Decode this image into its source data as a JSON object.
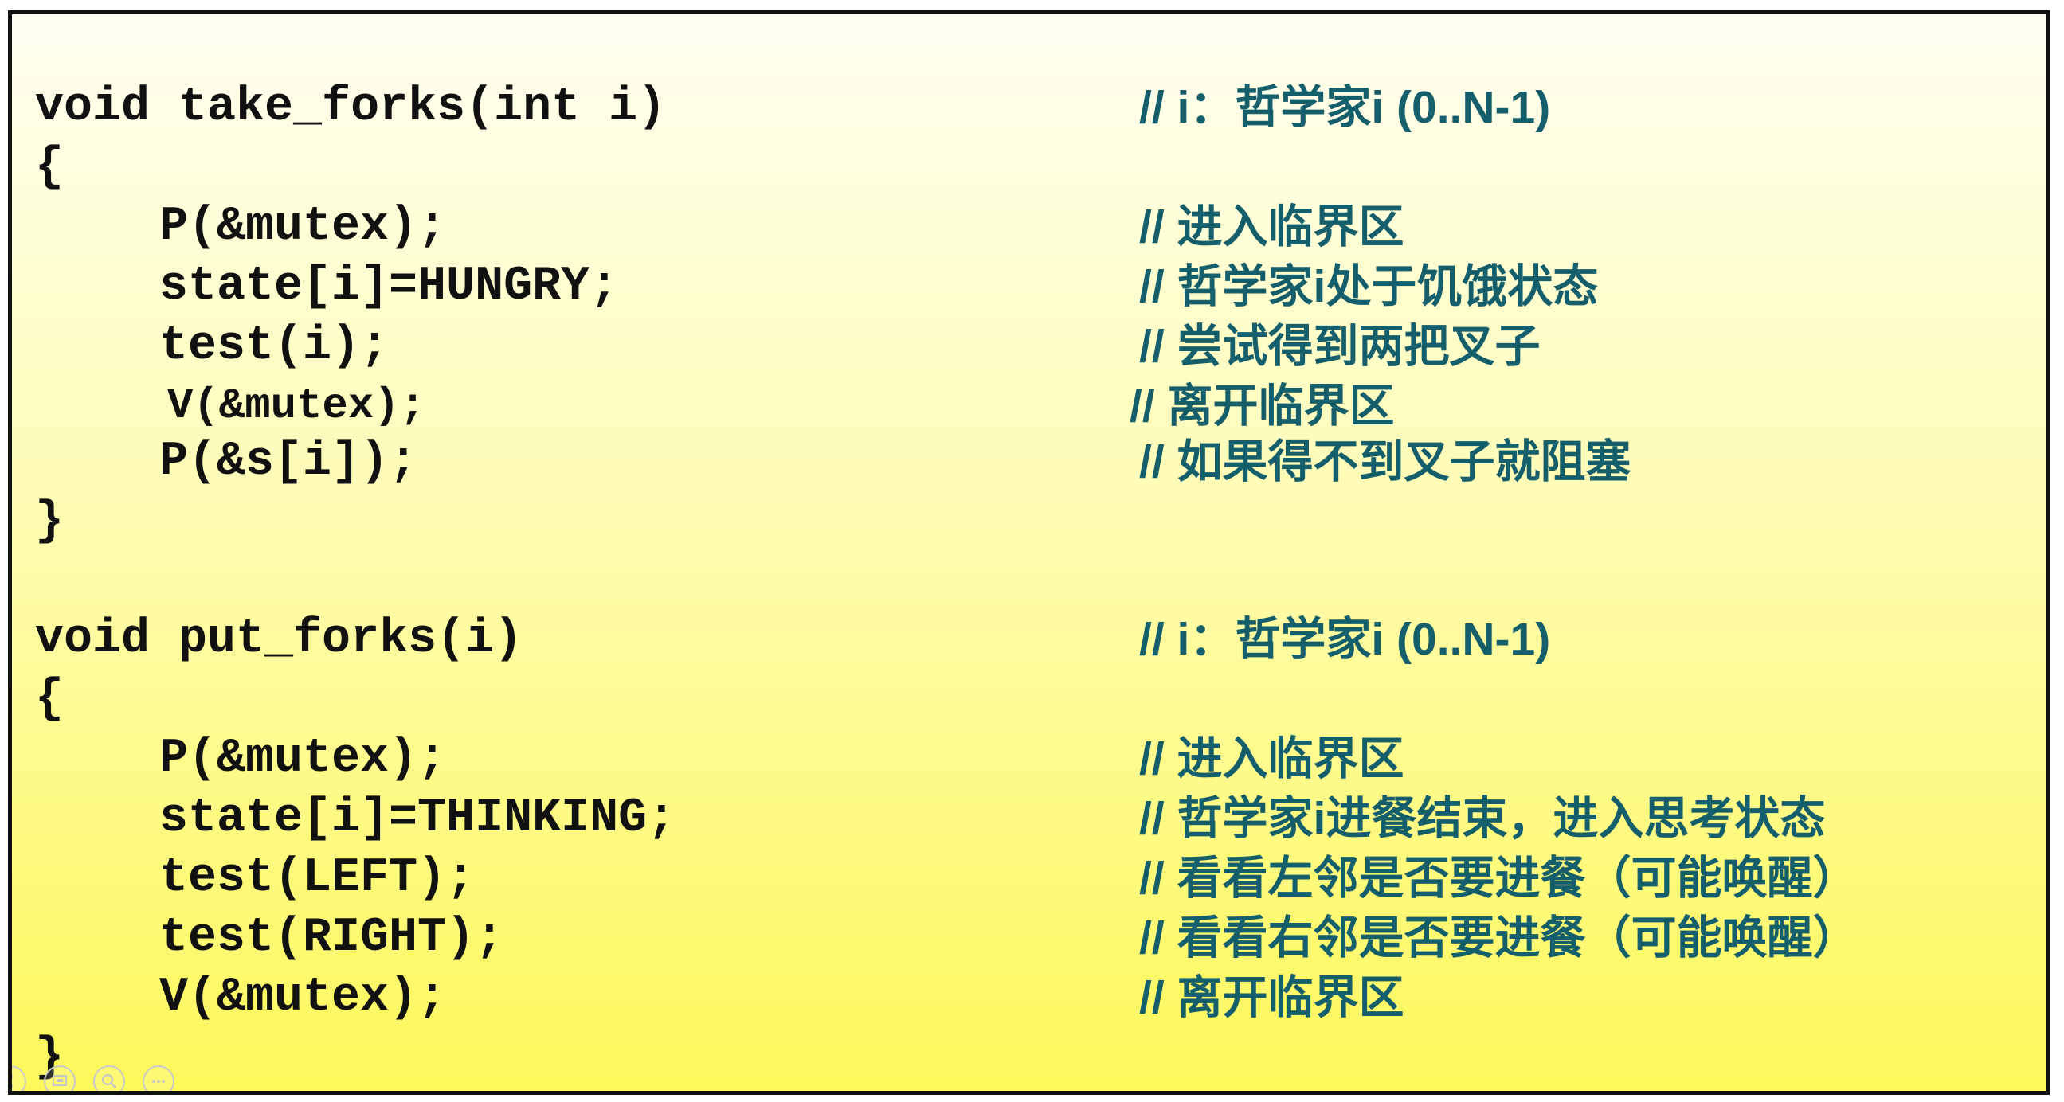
{
  "slide": {
    "lines": [
      {
        "code": "void take_forks(int i)",
        "comment": "// i：哲学家i (0..N-1)"
      },
      {
        "code": "{",
        "comment": ""
      },
      {
        "code": "P(&mutex);",
        "comment": "// 进入临界区"
      },
      {
        "code": "state[i]=HUNGRY;",
        "comment": "// 哲学家i处于饥饿状态"
      },
      {
        "code": "test(i);",
        "comment": "// 尝试得到两把叉子"
      },
      {
        "code": "V(&mutex);",
        "comment": "// 离开临界区"
      },
      {
        "code": "P(&s[i]);",
        "comment": "// 如果得不到叉子就阻塞"
      },
      {
        "code": "}",
        "comment": ""
      },
      {
        "code": "void put_forks(i)",
        "comment": "// i：哲学家i (0..N-1)"
      },
      {
        "code": "{",
        "comment": ""
      },
      {
        "code": "P(&mutex);",
        "comment": "// 进入临界区"
      },
      {
        "code": "state[i]=THINKING;",
        "comment": "// 哲学家i进餐结束，进入思考状态"
      },
      {
        "code": "test(LEFT);",
        "comment": "// 看看左邻是否要进餐（可能唤醒）"
      },
      {
        "code": "test(RIGHT);",
        "comment": "// 看看右邻是否要进餐（可能唤醒）"
      },
      {
        "code": "V(&mutex);",
        "comment": "// 离开临界区"
      },
      {
        "code": "}",
        "comment": ""
      }
    ]
  },
  "controls": {
    "icons": [
      "previous-icon",
      "slides-icon",
      "zoom-icon",
      "more-icon"
    ]
  },
  "colors": {
    "code_text": "#111111",
    "comment_text": "#155e6b",
    "border": "#111111",
    "bg_top": "#fffff2",
    "bg_bottom": "#fdf85a"
  }
}
